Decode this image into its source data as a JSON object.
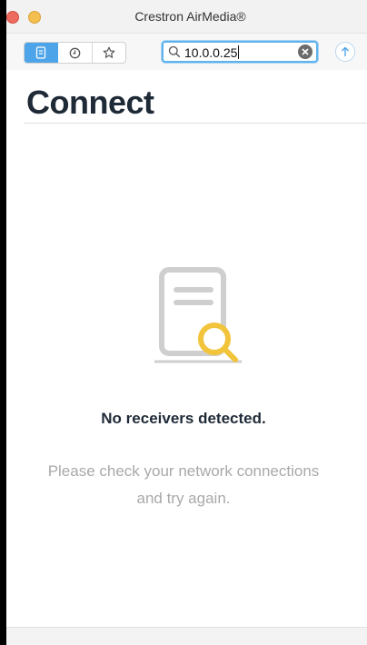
{
  "window": {
    "title": "Crestron AirMedia®"
  },
  "toolbar": {
    "tabs": [
      {
        "name": "receivers",
        "icon": "document-icon",
        "active": true
      },
      {
        "name": "history",
        "icon": "clock-icon",
        "active": false
      },
      {
        "name": "favorites",
        "icon": "star-icon",
        "active": false
      }
    ],
    "search": {
      "value": "10.0.0.25"
    }
  },
  "main": {
    "heading": "Connect",
    "empty_state": {
      "title": "No receivers detected.",
      "description_line1": "Please check your network connections",
      "description_line2": "and try again."
    }
  },
  "colors": {
    "accent": "#4ea4e8",
    "heading": "#1f2a37",
    "muted": "#a9a9a9",
    "magnifier": "#f2c43b"
  }
}
